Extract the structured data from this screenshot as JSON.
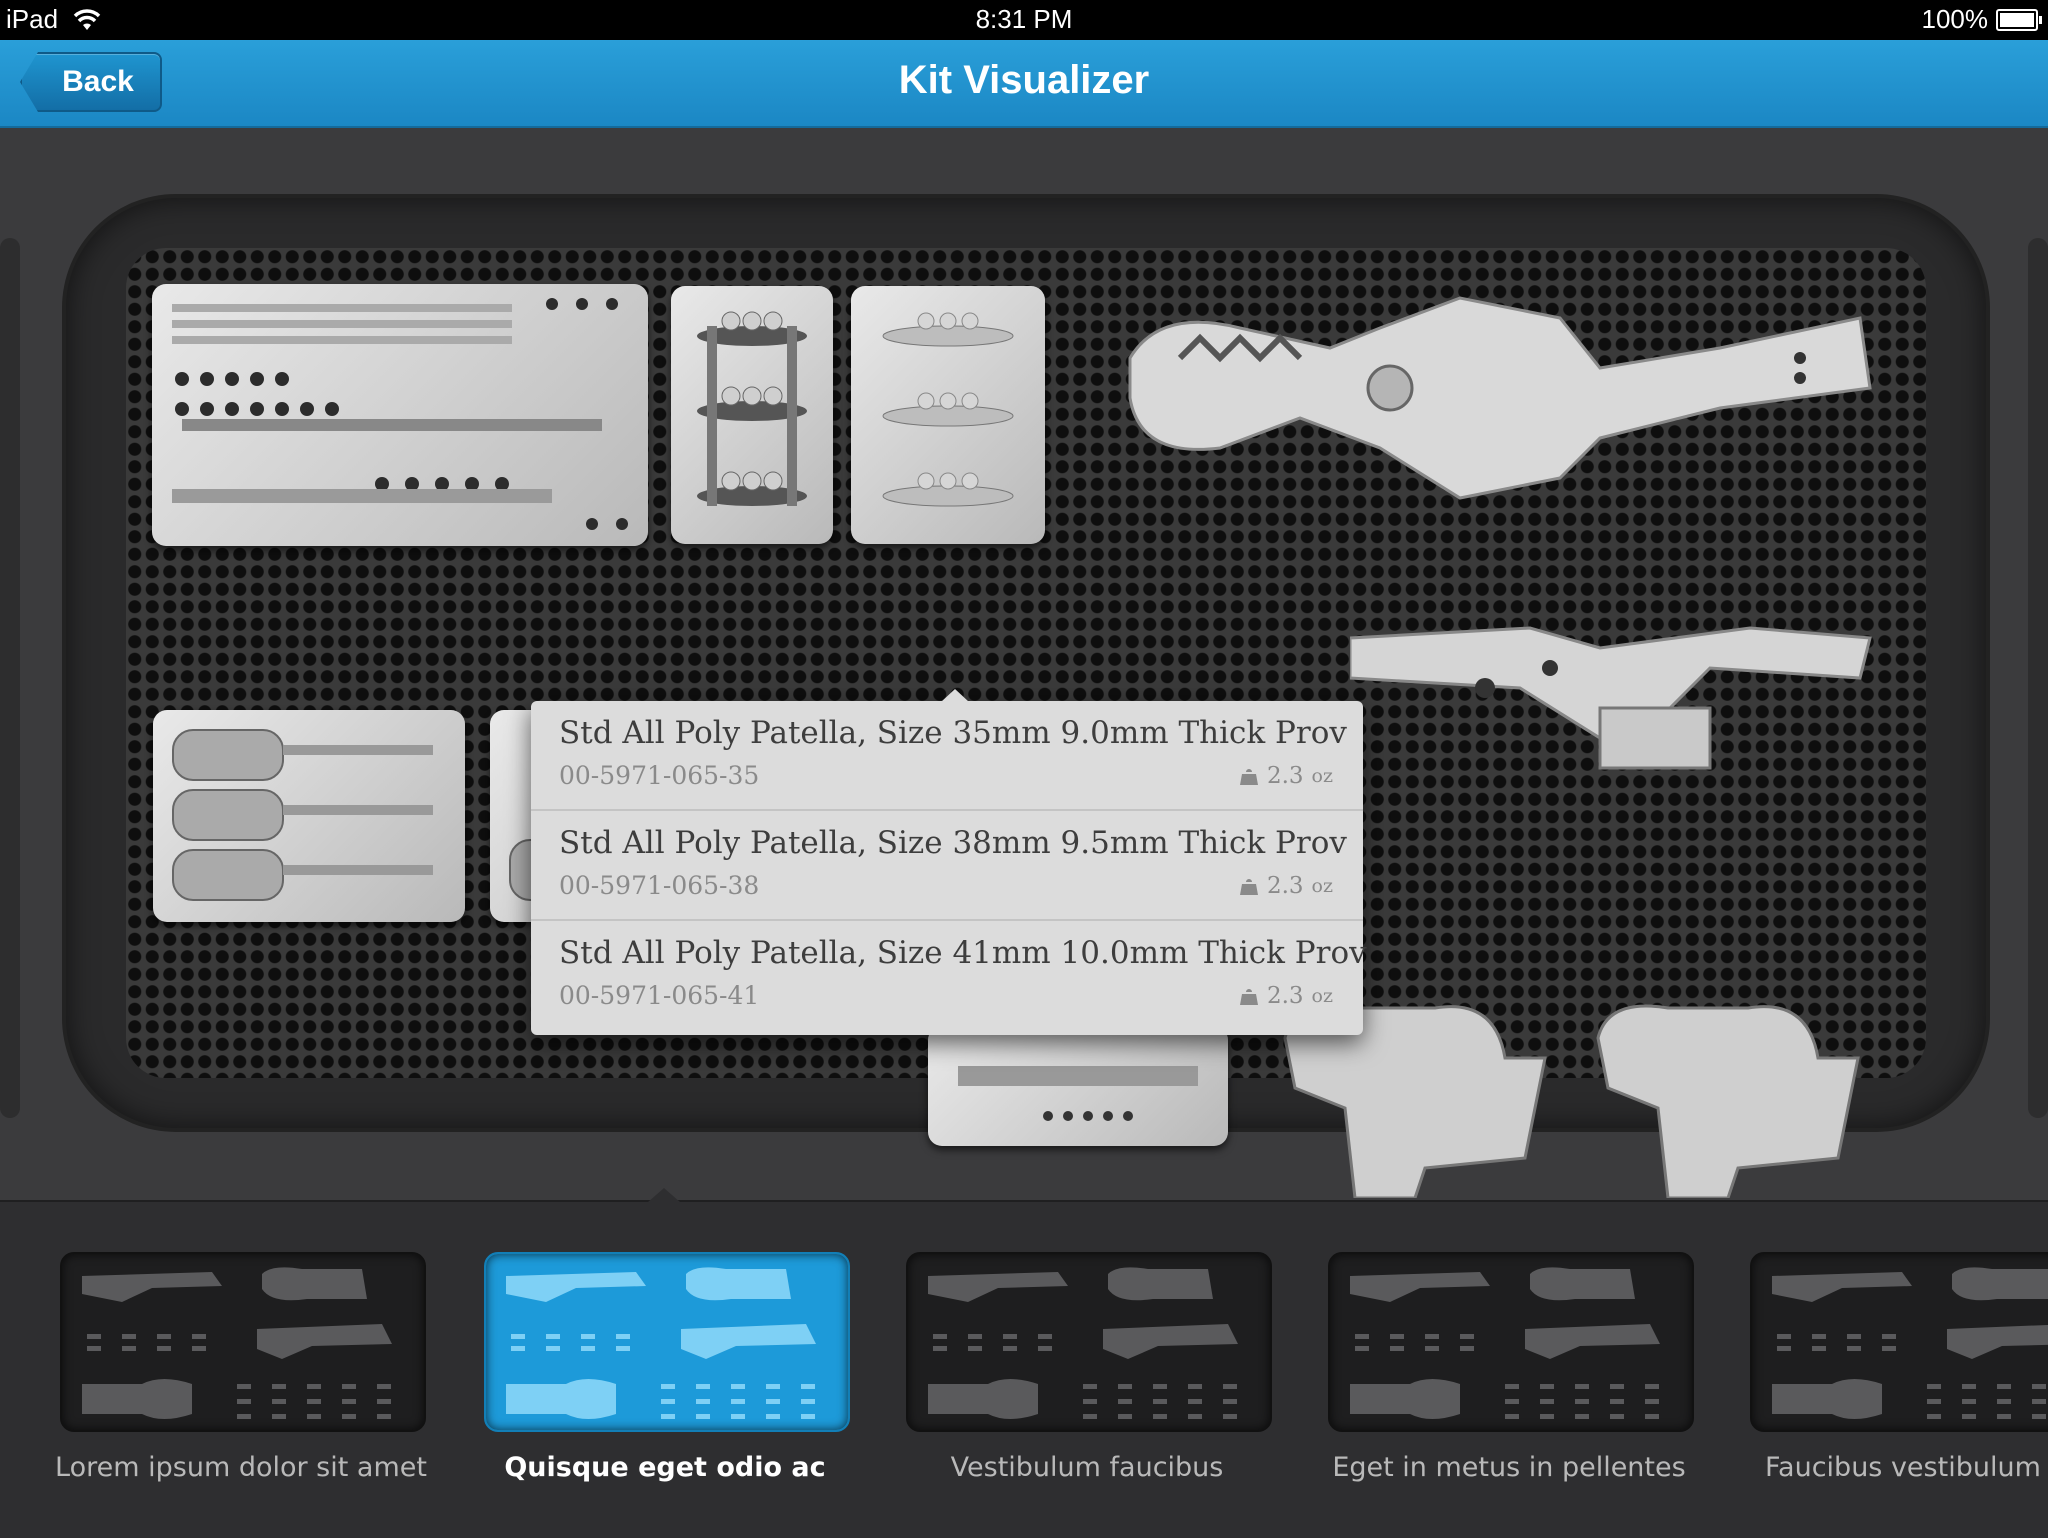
{
  "status_bar": {
    "device": "iPad",
    "wifi_icon": "wifi-icon",
    "time": "8:31 PM",
    "battery_percent": "100%",
    "battery_icon": "battery-icon",
    "battery_level": 1.0
  },
  "nav": {
    "back_label": "Back",
    "title": "Kit Visualizer"
  },
  "popover": {
    "items": [
      {
        "name": "Std All Poly Patella, Size 35mm 9.0mm Thick Prov",
        "code": "00-5971-065-35",
        "weight": "2.3",
        "unit": "oz",
        "icon": "weight-icon"
      },
      {
        "name": "Std All Poly Patella, Size 38mm 9.5mm Thick Prov",
        "code": "00-5971-065-38",
        "weight": "2.3",
        "unit": "oz",
        "icon": "weight-icon"
      },
      {
        "name": "Std All Poly Patella, Size 41mm 10.0mm Thick Prov",
        "code": "00-5971-065-41",
        "weight": "2.3",
        "unit": "oz",
        "icon": "weight-icon"
      }
    ]
  },
  "kits": {
    "selected_index": 1,
    "items": [
      {
        "label": "Lorem ipsum dolor sit amet"
      },
      {
        "label": "Quisque eget odio ac"
      },
      {
        "label": "Vestibulum faucibus"
      },
      {
        "label": "Eget in metus in pellentes"
      },
      {
        "label": "Faucibus vestibulum"
      }
    ]
  },
  "colors": {
    "nav_blue": "#1f95d0",
    "selected_kit": "#1d9ad9",
    "background": "#3b3b3d"
  }
}
